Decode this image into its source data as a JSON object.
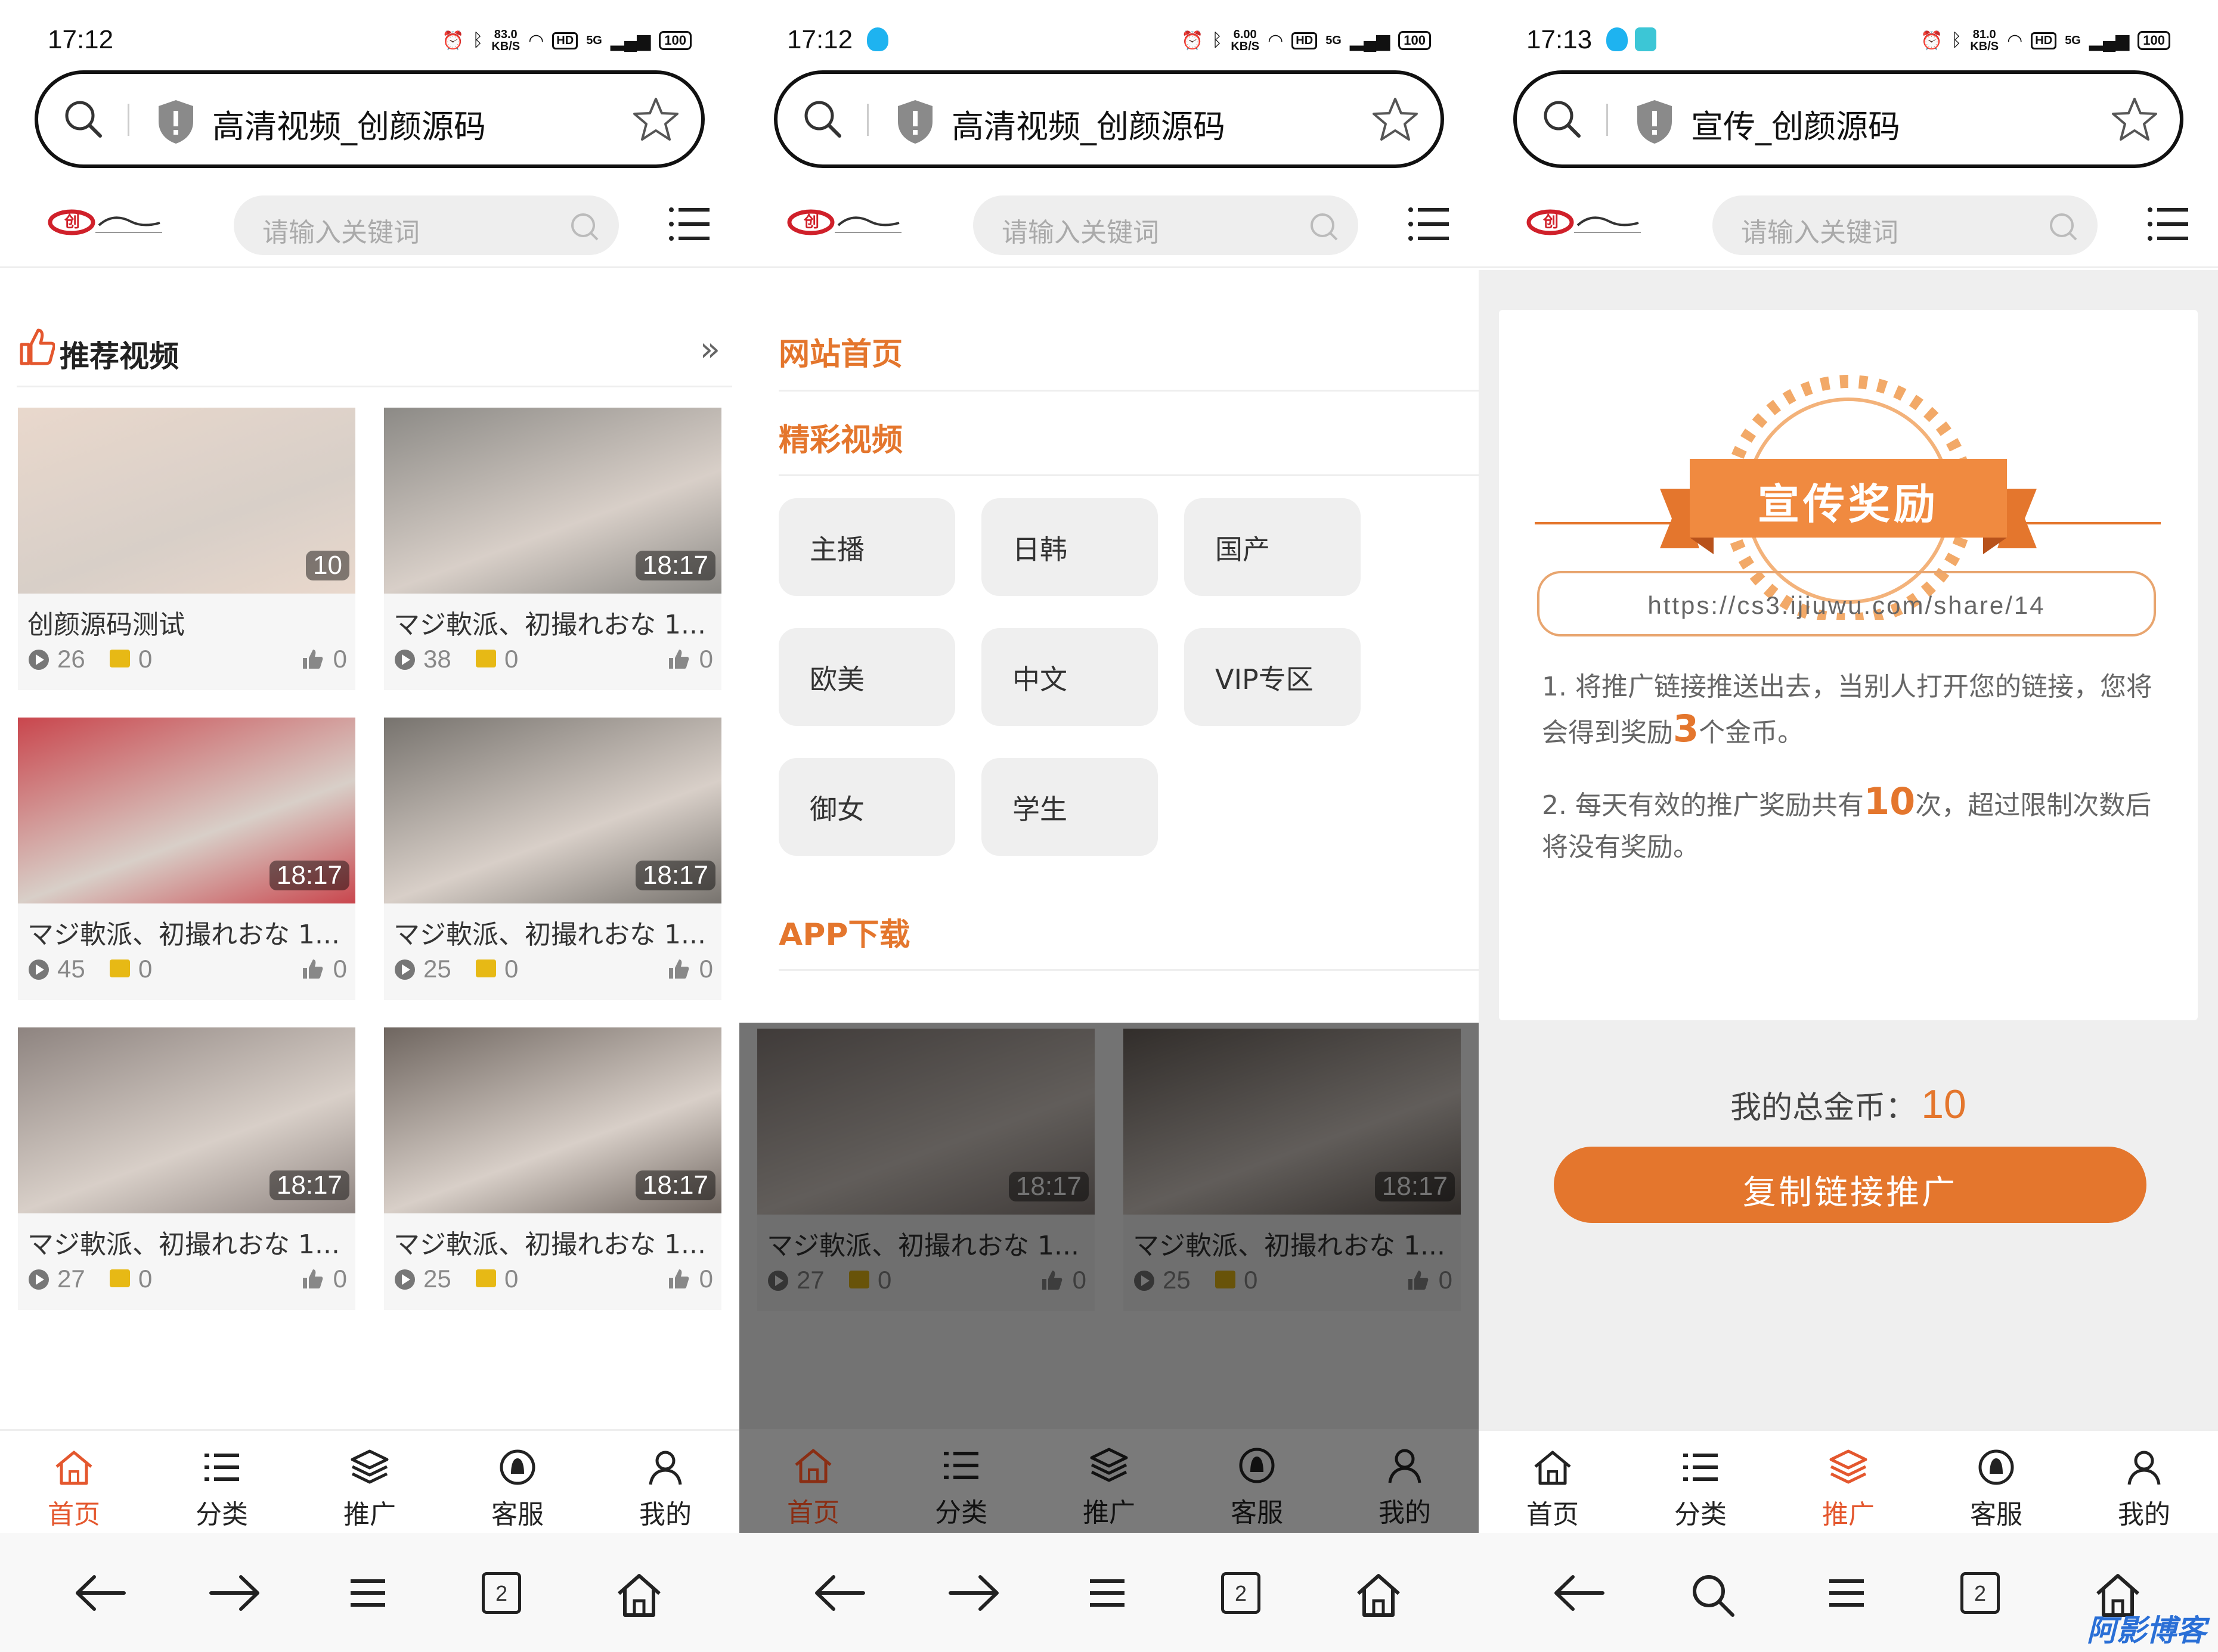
{
  "panels": [
    {
      "time": "17:12",
      "speed_top": "83.0",
      "speed_unit": "KB/S",
      "network": "5G",
      "battery": "100",
      "hd": "HD",
      "page_title": "高清视频_创颜源码"
    },
    {
      "time": "17:12",
      "speed_top": "6.00",
      "speed_unit": "KB/S",
      "network": "5G",
      "battery": "100",
      "hd": "HD",
      "page_title": "高清视频_创颜源码"
    },
    {
      "time": "17:13",
      "speed_top": "81.0",
      "speed_unit": "KB/S",
      "network": "5G",
      "battery": "100",
      "hd": "HD",
      "page_title": "宣传_创颜源码"
    }
  ],
  "search_placeholder": "请输入关键词",
  "section_title": "推荐视频",
  "more_symbol": "»",
  "videos": [
    {
      "title": "创颜源码测试",
      "duration": "10",
      "views": "26",
      "coins": "0",
      "likes": "0",
      "thumb_color": "#e9d8cc"
    },
    {
      "title": "マジ軟派、初撮れおな 1...",
      "duration": "18:17",
      "views": "38",
      "coins": "0",
      "likes": "0",
      "thumb_color": "#8c8a86"
    },
    {
      "title": "マジ軟派、初撮れおな 1...",
      "duration": "18:17",
      "views": "45",
      "coins": "0",
      "likes": "0",
      "thumb_color": "#c9464d"
    },
    {
      "title": "マジ軟派、初撮れおな 1...",
      "duration": "18:17",
      "views": "25",
      "coins": "0",
      "likes": "0",
      "thumb_color": "#77736e"
    },
    {
      "title": "マジ軟派、初撮れおな 1...",
      "duration": "18:17",
      "views": "27",
      "coins": "0",
      "likes": "0",
      "thumb_color": "#8e8480"
    },
    {
      "title": "マジ軟派、初撮れおな 1...",
      "duration": "18:17",
      "views": "25",
      "coins": "0",
      "likes": "0",
      "thumb_color": "#6f6660"
    }
  ],
  "menu": {
    "home": "网站首页",
    "videos": "精彩视频",
    "categories": [
      "主播",
      "日韩",
      "国产",
      "欧美",
      "中文",
      "VIP专区",
      "御女",
      "学生"
    ],
    "app": "APP下载"
  },
  "nav": [
    "首页",
    "分类",
    "推广",
    "客服",
    "我的"
  ],
  "promo": {
    "badge": "宣传奖励",
    "rule1_a": "1. 将推广链接推送出去，当别人打开您的链接，您将会得到奖励",
    "rule1_num": "3",
    "rule1_b": "个金币。",
    "rule2_a": "2. 每天有效的推广奖励共有",
    "rule2_num": "10",
    "rule2_b": "次，超过限制次数后将没有奖励。",
    "link": "https://cs3.ijiuwu.com/share/14",
    "total_label": "我的总金币：",
    "total_value": "10",
    "copy_button": "复制链接推广"
  },
  "tab_count": "2",
  "watermark": "阿影博客",
  "colors": {
    "accent": "#e4762d",
    "nav_active": "#e4572e"
  }
}
